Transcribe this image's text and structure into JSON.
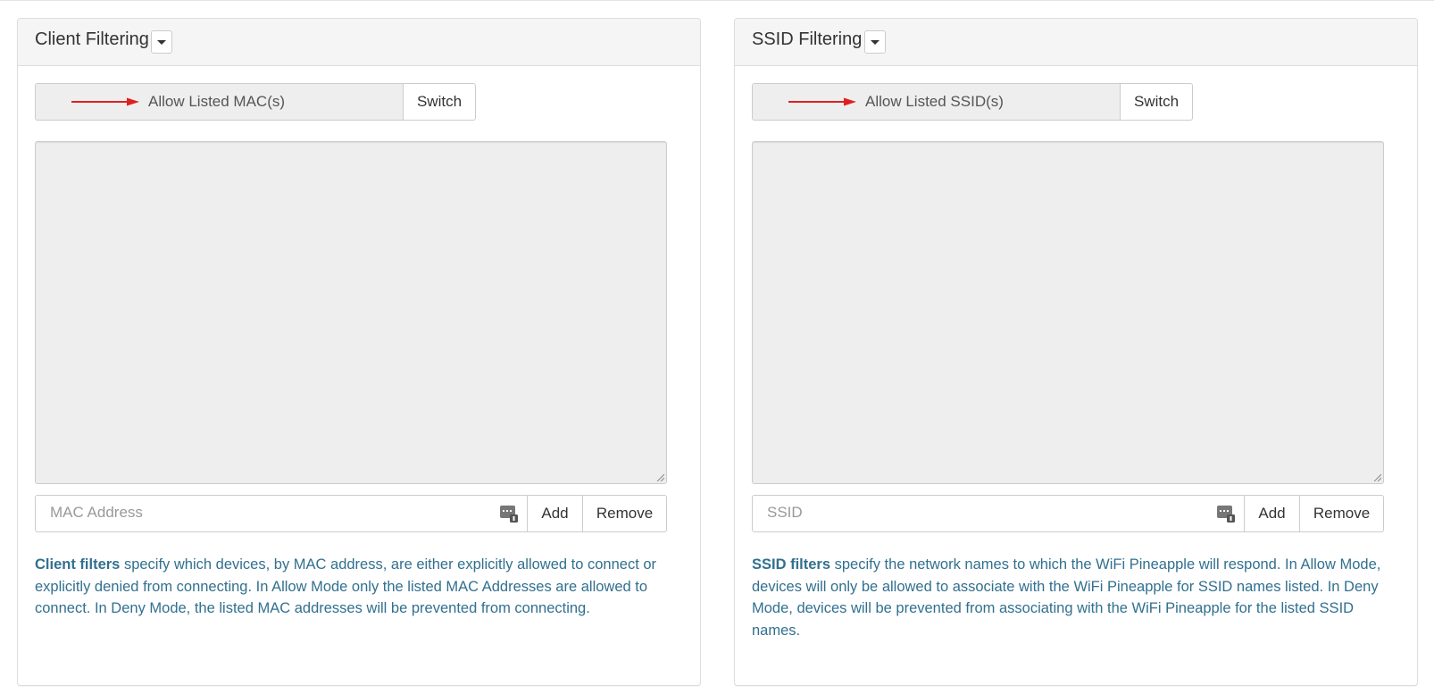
{
  "client_panel": {
    "title": "Client Filtering",
    "mode_label": "Allow Listed MAC(s)",
    "switch_label": "Switch",
    "input_placeholder": "MAC Address",
    "add_label": "Add",
    "remove_label": "Remove",
    "help_bold": "Client filters",
    "help_text": " specify which devices, by MAC address, are either explicitly allowed to connect or explicitly denied from connecting. In Allow Mode only the listed MAC Addresses are allowed to connect. In Deny Mode, the listed MAC addresses will be prevented from connecting."
  },
  "ssid_panel": {
    "title": "SSID Filtering",
    "mode_label": "Allow Listed SSID(s)",
    "switch_label": "Switch",
    "input_placeholder": "SSID",
    "add_label": "Add",
    "remove_label": "Remove",
    "help_bold": "SSID filters",
    "help_text": " specify the network names to which the WiFi Pineapple will respond. In Allow Mode, devices will only be allowed to associate with the WiFi Pineapple for SSID names listed. In Deny Mode, devices will be prevented from associating with the WiFi Pineapple for the listed SSID names."
  },
  "icons": {
    "dropdown": "caret-down-icon",
    "arrow": "red-arrow-icon",
    "keyboard": "keyboard-icon",
    "resize": "resize-grip-icon"
  },
  "colors": {
    "help_text": "#31708f",
    "arrow": "#e02020",
    "panel_heading": "#f5f5f5",
    "list_bg": "#eeeeee"
  }
}
